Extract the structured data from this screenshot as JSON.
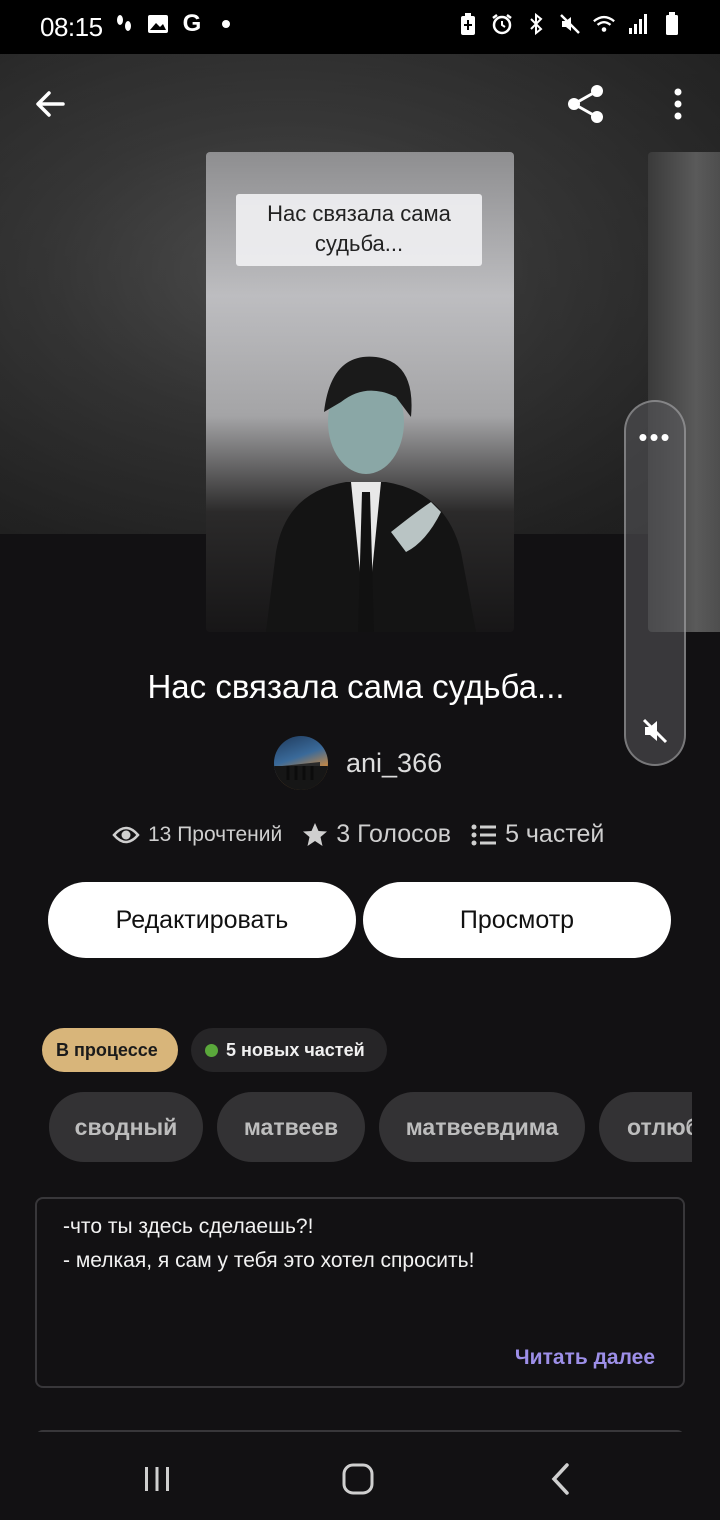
{
  "status_bar": {
    "time": "08:15",
    "left_icons": [
      "steps-icon",
      "image-icon",
      "google-icon",
      "dot-icon"
    ],
    "right_icons": [
      "battery-saver-icon",
      "alarm-icon",
      "bluetooth-icon",
      "mute-icon",
      "wifi-icon",
      "signal-icon",
      "battery-icon"
    ],
    "google_letter": "G"
  },
  "toolbar": {
    "back_icon": "arrow-left-icon",
    "share_icon": "share-icon",
    "more_icon": "more-vertical-icon"
  },
  "cover": {
    "caption": "Нас связала сама судьба..."
  },
  "side_panel": {
    "dots": "•••",
    "mute_icon": "volume-mute-icon"
  },
  "story": {
    "title": "Нас связала сама судьба...",
    "author": "ani_366",
    "reads": "13 Прочтений",
    "votes": "3 Голосов",
    "parts": "5 частей"
  },
  "buttons": {
    "edit": "Редактировать",
    "preview": "Просмотр"
  },
  "chips": {
    "status": "В процессе",
    "new_parts": "5 новых частей"
  },
  "tags": [
    "сводный",
    "матвеев",
    "матвеевдима",
    "отлюбв"
  ],
  "description": {
    "line1": "-что ты здесь сделаешь?!",
    "line2": "- мелкая, я сам у тебя это хотел спросить!",
    "read_more": "Читать далее"
  },
  "nav": {
    "recents_icon": "recents-icon",
    "home_icon": "home-icon",
    "back_icon": "back-chevron-icon"
  }
}
